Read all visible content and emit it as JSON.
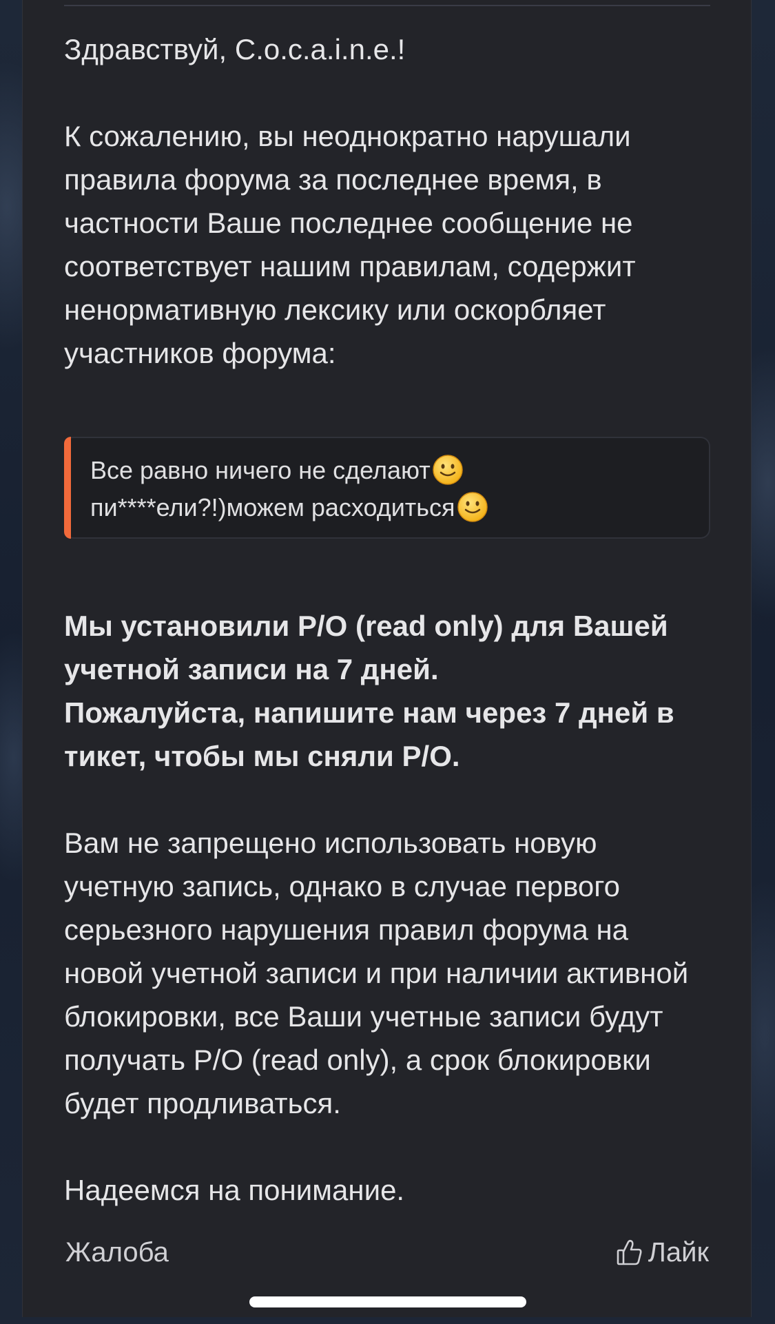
{
  "message": {
    "greeting": "Здравствуй, C.o.c.a.i.n.e.!",
    "violation_text": "К сожалению, вы неоднократно нарушали правила форума за последнее время, в частности Ваше последнее сообщение не соответствует нашим правилам, содержит ненормативную лексику или оскорбляет участников форума:",
    "quote_lines": [
      "Все равно ничего не сделают",
      "пи****ели?!)можем расходиться"
    ],
    "quote_accent_color": "#f26a3b",
    "bold_line_1": "Мы установили Р/О (read only) для Вашей учетной записи на 7 дней.",
    "bold_line_2": "Пожалуйста, напишите нам через 7 дней в тикет, чтобы мы сняли Р/О.",
    "info_text": "Вам не запрещено использовать новую учетную запись, однако в случае первого серьезного нарушения правил форума на новой учетной записи и при наличии активной блокировки, все Ваши учетные записи будут получать Р/О (read only), а срок блокировки будет продливаться.",
    "closing": "Надеемся на понимание."
  },
  "actions": {
    "report_label": "Жалоба",
    "like_label": "Лайк",
    "like_icon": "thumbs-up-icon"
  },
  "emoji": "slightly-smiling-face-icon"
}
